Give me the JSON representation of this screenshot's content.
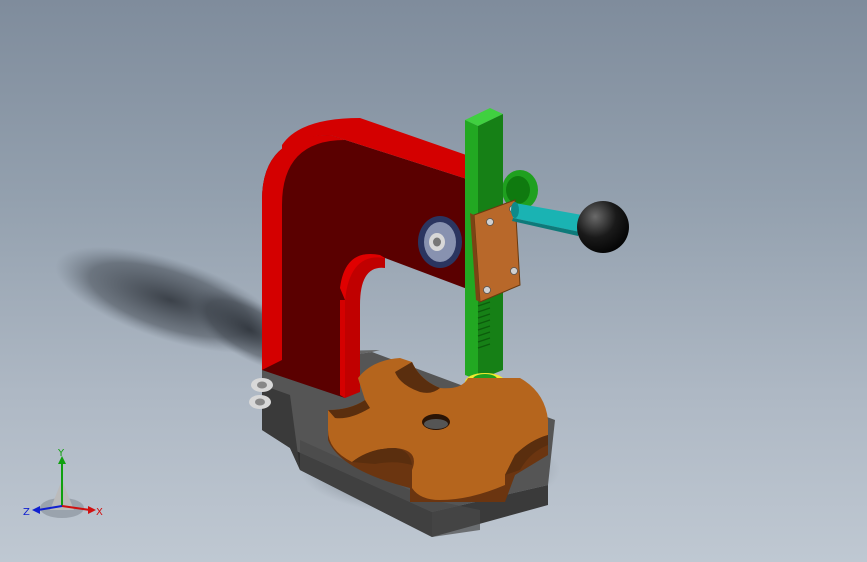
{
  "viewport": {
    "background_top": "#7f8c9c",
    "background_bottom": "#bfc8d2"
  },
  "model": {
    "frame_color": "#d40000",
    "frame_shade": "#5a0000",
    "base_color": "#3c3c3c",
    "table_color": "#b5651d",
    "ram_color": "#1fa01f",
    "collar_color": "#e6dc00",
    "handle_color": "#1ab3b3",
    "knob_color": "#151515",
    "plate_color": "#b8682a"
  },
  "triad": {
    "x_label": "X",
    "y_label": "Y",
    "z_label": "Z",
    "x_color": "#d01010",
    "y_color": "#10a010",
    "z_color": "#1020d0"
  }
}
